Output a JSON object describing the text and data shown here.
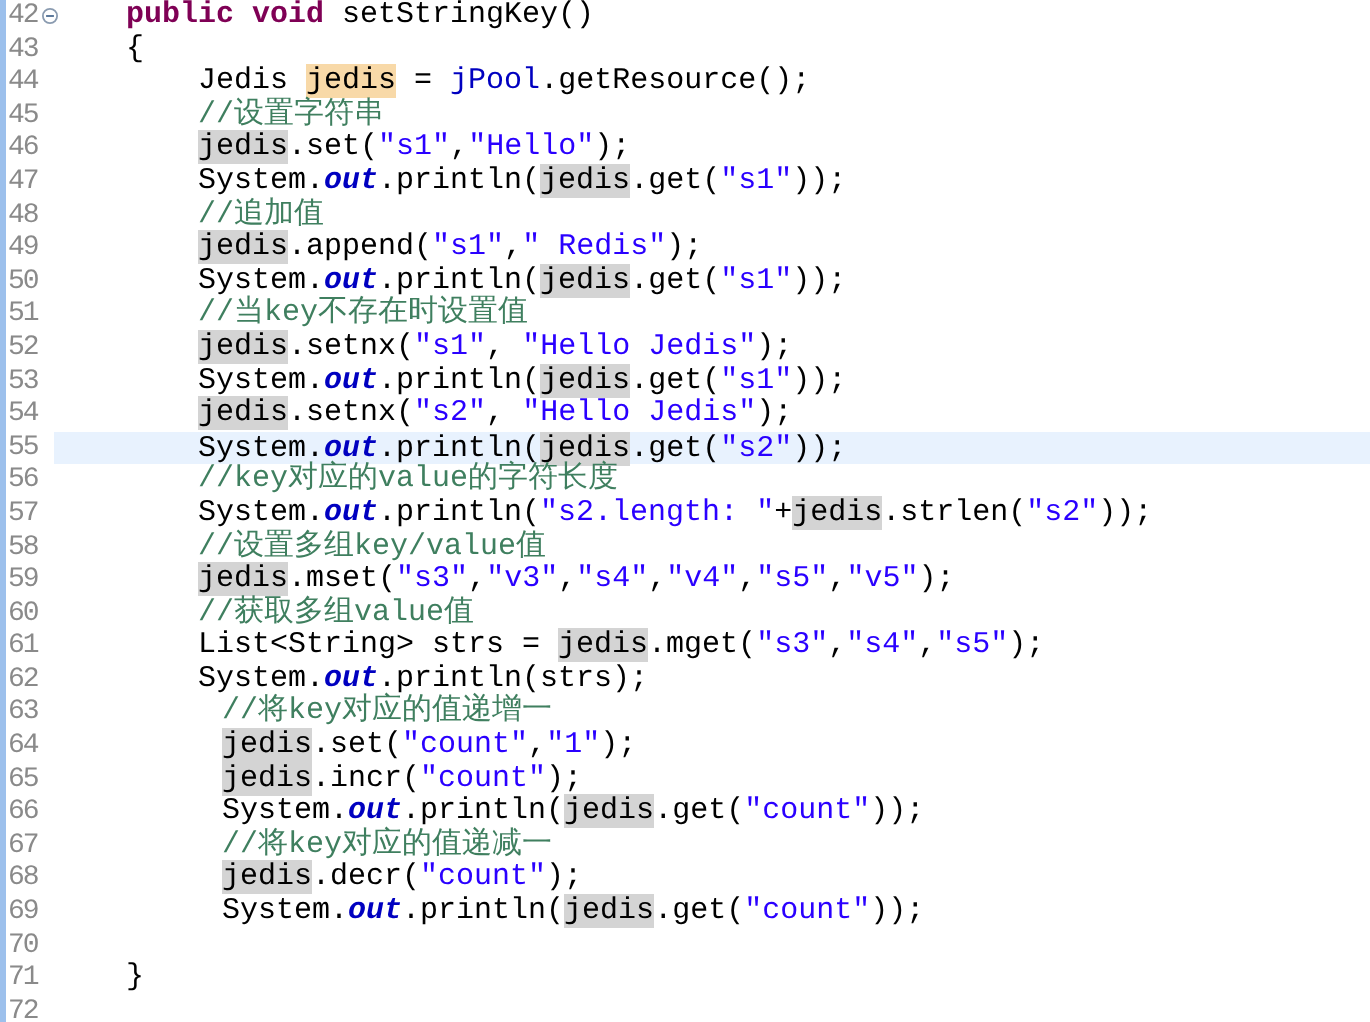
{
  "editor": {
    "lines": [
      {
        "number": "42",
        "fold": true,
        "current": false,
        "tokens": [
          {
            "kind": "kw",
            "text": "public void"
          },
          {
            "kind": "code",
            "text": " setStringKey()"
          }
        ]
      },
      {
        "number": "43",
        "fold": false,
        "current": false,
        "tokens": [
          {
            "kind": "code",
            "text": "{"
          }
        ],
        "children": [
          {
            "number": "44",
            "fold": false,
            "current": false,
            "tokens": [
              {
                "kind": "code",
                "text": "Jedis "
              },
              {
                "kind": "decl",
                "text": "jedis"
              },
              {
                "kind": "code",
                "text": " = "
              },
              {
                "kind": "var",
                "text": "jPool"
              },
              {
                "kind": "code",
                "text": ".getResource();"
              }
            ]
          },
          {
            "number": "45",
            "fold": false,
            "current": false,
            "tokens": [
              {
                "kind": "cmt",
                "text": "//设置字符串"
              }
            ]
          },
          {
            "number": "46",
            "fold": false,
            "current": false,
            "tokens": [
              {
                "kind": "ref",
                "text": "jedis"
              },
              {
                "kind": "code",
                "text": ".set("
              },
              {
                "kind": "str",
                "text": "\"s1\""
              },
              {
                "kind": "code",
                "text": ","
              },
              {
                "kind": "str",
                "text": "\"Hello\""
              },
              {
                "kind": "code",
                "text": ");"
              }
            ]
          },
          {
            "number": "47",
            "fold": false,
            "current": false,
            "tokens": [
              {
                "kind": "code",
                "text": "System."
              },
              {
                "kind": "field",
                "text": "out"
              },
              {
                "kind": "code",
                "text": ".println("
              },
              {
                "kind": "ref",
                "text": "jedis"
              },
              {
                "kind": "code",
                "text": ".get("
              },
              {
                "kind": "str",
                "text": "\"s1\""
              },
              {
                "kind": "code",
                "text": "));"
              }
            ]
          },
          {
            "number": "48",
            "fold": false,
            "current": false,
            "tokens": [
              {
                "kind": "cmt",
                "text": "//追加值"
              }
            ]
          },
          {
            "number": "49",
            "fold": false,
            "current": false,
            "tokens": [
              {
                "kind": "ref",
                "text": "jedis"
              },
              {
                "kind": "code",
                "text": ".append("
              },
              {
                "kind": "str",
                "text": "\"s1\""
              },
              {
                "kind": "code",
                "text": ","
              },
              {
                "kind": "str",
                "text": "\" Redis\""
              },
              {
                "kind": "code",
                "text": ");"
              }
            ]
          },
          {
            "number": "50",
            "fold": false,
            "current": false,
            "tokens": [
              {
                "kind": "code",
                "text": "System."
              },
              {
                "kind": "field",
                "text": "out"
              },
              {
                "kind": "code",
                "text": ".println("
              },
              {
                "kind": "ref",
                "text": "jedis"
              },
              {
                "kind": "code",
                "text": ".get("
              },
              {
                "kind": "str",
                "text": "\"s1\""
              },
              {
                "kind": "code",
                "text": "));"
              }
            ]
          },
          {
            "number": "51",
            "fold": false,
            "current": false,
            "tokens": [
              {
                "kind": "cmt",
                "text": "//当key不存在时设置值"
              }
            ]
          },
          {
            "number": "52",
            "fold": false,
            "current": false,
            "tokens": [
              {
                "kind": "ref",
                "text": "jedis"
              },
              {
                "kind": "code",
                "text": ".setnx("
              },
              {
                "kind": "str",
                "text": "\"s1\""
              },
              {
                "kind": "code",
                "text": ", "
              },
              {
                "kind": "str",
                "text": "\"Hello Jedis\""
              },
              {
                "kind": "code",
                "text": ");"
              }
            ]
          },
          {
            "number": "53",
            "fold": false,
            "current": false,
            "tokens": [
              {
                "kind": "code",
                "text": "System."
              },
              {
                "kind": "field",
                "text": "out"
              },
              {
                "kind": "code",
                "text": ".println("
              },
              {
                "kind": "ref",
                "text": "jedis"
              },
              {
                "kind": "code",
                "text": ".get("
              },
              {
                "kind": "str",
                "text": "\"s1\""
              },
              {
                "kind": "code",
                "text": "));"
              }
            ]
          },
          {
            "number": "54",
            "fold": false,
            "current": false,
            "tokens": [
              {
                "kind": "ref",
                "text": "jedis"
              },
              {
                "kind": "code",
                "text": ".setnx("
              },
              {
                "kind": "str",
                "text": "\"s2\""
              },
              {
                "kind": "code",
                "text": ", "
              },
              {
                "kind": "str",
                "text": "\"Hello Jedis\""
              },
              {
                "kind": "code",
                "text": ");"
              }
            ]
          },
          {
            "number": "55",
            "fold": false,
            "current": true,
            "tokens": [
              {
                "kind": "code",
                "text": "System."
              },
              {
                "kind": "field",
                "text": "out"
              },
              {
                "kind": "code",
                "text": ".println("
              },
              {
                "kind": "ref",
                "text": "jedis",
                "caret": true
              },
              {
                "kind": "code",
                "text": ".get("
              },
              {
                "kind": "str",
                "text": "\"s2\""
              },
              {
                "kind": "code",
                "text": "));"
              }
            ]
          },
          {
            "number": "56",
            "fold": false,
            "current": false,
            "tokens": [
              {
                "kind": "cmt",
                "text": "//key对应的value的字符长度"
              }
            ]
          },
          {
            "number": "57",
            "fold": false,
            "current": false,
            "tokens": [
              {
                "kind": "code",
                "text": "System."
              },
              {
                "kind": "field",
                "text": "out"
              },
              {
                "kind": "code",
                "text": ".println("
              },
              {
                "kind": "str",
                "text": "\"s2.length: \""
              },
              {
                "kind": "code",
                "text": "+"
              },
              {
                "kind": "ref",
                "text": "jedis"
              },
              {
                "kind": "code",
                "text": ".strlen("
              },
              {
                "kind": "str",
                "text": "\"s2\""
              },
              {
                "kind": "code",
                "text": "));"
              }
            ]
          },
          {
            "number": "58",
            "fold": false,
            "current": false,
            "tokens": [
              {
                "kind": "cmt",
                "text": "//设置多组key/value值"
              }
            ]
          },
          {
            "number": "59",
            "fold": false,
            "current": false,
            "tokens": [
              {
                "kind": "ref",
                "text": "jedis"
              },
              {
                "kind": "code",
                "text": ".mset("
              },
              {
                "kind": "str",
                "text": "\"s3\""
              },
              {
                "kind": "code",
                "text": ","
              },
              {
                "kind": "str",
                "text": "\"v3\""
              },
              {
                "kind": "code",
                "text": ","
              },
              {
                "kind": "str",
                "text": "\"s4\""
              },
              {
                "kind": "code",
                "text": ","
              },
              {
                "kind": "str",
                "text": "\"v4\""
              },
              {
                "kind": "code",
                "text": ","
              },
              {
                "kind": "str",
                "text": "\"s5\""
              },
              {
                "kind": "code",
                "text": ","
              },
              {
                "kind": "str",
                "text": "\"v5\""
              },
              {
                "kind": "code",
                "text": ");"
              }
            ]
          },
          {
            "number": "60",
            "fold": false,
            "current": false,
            "tokens": [
              {
                "kind": "cmt",
                "text": "//获取多组value值"
              }
            ]
          },
          {
            "number": "61",
            "fold": false,
            "current": false,
            "tokens": [
              {
                "kind": "code",
                "text": "List<String> strs = "
              },
              {
                "kind": "ref",
                "text": "jedis"
              },
              {
                "kind": "code",
                "text": ".mget("
              },
              {
                "kind": "str",
                "text": "\"s3\""
              },
              {
                "kind": "code",
                "text": ","
              },
              {
                "kind": "str",
                "text": "\"s4\""
              },
              {
                "kind": "code",
                "text": ","
              },
              {
                "kind": "str",
                "text": "\"s5\""
              },
              {
                "kind": "code",
                "text": ");"
              }
            ]
          },
          {
            "number": "62",
            "fold": false,
            "current": false,
            "tokens": [
              {
                "kind": "code",
                "text": "System."
              },
              {
                "kind": "field",
                "text": "out"
              },
              {
                "kind": "code",
                "text": ".println(strs);"
              }
            ],
            "children": [
              {
                "number": "63",
                "fold": false,
                "current": false,
                "tokens": [
                  {
                    "kind": "cmt",
                    "text": "//将key对应的值递增一"
                  }
                ]
              },
              {
                "number": "64",
                "fold": false,
                "current": false,
                "tokens": [
                  {
                    "kind": "ref",
                    "text": "jedis"
                  },
                  {
                    "kind": "code",
                    "text": ".set("
                  },
                  {
                    "kind": "str",
                    "text": "\"count\""
                  },
                  {
                    "kind": "code",
                    "text": ","
                  },
                  {
                    "kind": "str",
                    "text": "\"1\""
                  },
                  {
                    "kind": "code",
                    "text": ");"
                  }
                ]
              },
              {
                "number": "65",
                "fold": false,
                "current": false,
                "tokens": [
                  {
                    "kind": "ref",
                    "text": "jedis"
                  },
                  {
                    "kind": "code",
                    "text": ".incr("
                  },
                  {
                    "kind": "str",
                    "text": "\"count\""
                  },
                  {
                    "kind": "code",
                    "text": ");"
                  }
                ]
              },
              {
                "number": "66",
                "fold": false,
                "current": false,
                "tokens": [
                  {
                    "kind": "code",
                    "text": "System."
                  },
                  {
                    "kind": "field",
                    "text": "out"
                  },
                  {
                    "kind": "code",
                    "text": ".println("
                  },
                  {
                    "kind": "ref",
                    "text": "jedis"
                  },
                  {
                    "kind": "code",
                    "text": ".get("
                  },
                  {
                    "kind": "str",
                    "text": "\"count\""
                  },
                  {
                    "kind": "code",
                    "text": "));"
                  }
                ]
              },
              {
                "number": "67",
                "fold": false,
                "current": false,
                "tokens": [
                  {
                    "kind": "cmt",
                    "text": "//将key对应的值递减一"
                  }
                ]
              },
              {
                "number": "68",
                "fold": false,
                "current": false,
                "tokens": [
                  {
                    "kind": "ref",
                    "text": "jedis"
                  },
                  {
                    "kind": "code",
                    "text": ".decr("
                  },
                  {
                    "kind": "str",
                    "text": "\"count\""
                  },
                  {
                    "kind": "code",
                    "text": ");"
                  }
                ]
              },
              {
                "number": "69",
                "fold": false,
                "current": false,
                "tokens": [
                  {
                    "kind": "code",
                    "text": "System."
                  },
                  {
                    "kind": "field",
                    "text": "out"
                  },
                  {
                    "kind": "code",
                    "text": ".println("
                  },
                  {
                    "kind": "ref",
                    "text": "jedis"
                  },
                  {
                    "kind": "code",
                    "text": ".get("
                  },
                  {
                    "kind": "str",
                    "text": "\"count\""
                  },
                  {
                    "kind": "code",
                    "text": "));"
                  }
                ]
              }
            ]
          }
        ]
      },
      {
        "number": "70",
        "fold": false,
        "current": false
      },
      {
        "number": "71",
        "fold": false,
        "current": false,
        "tokens": [
          {
            "kind": "code",
            "text": "}"
          }
        ]
      },
      {
        "number": "72",
        "fold": false,
        "current": false
      }
    ]
  }
}
